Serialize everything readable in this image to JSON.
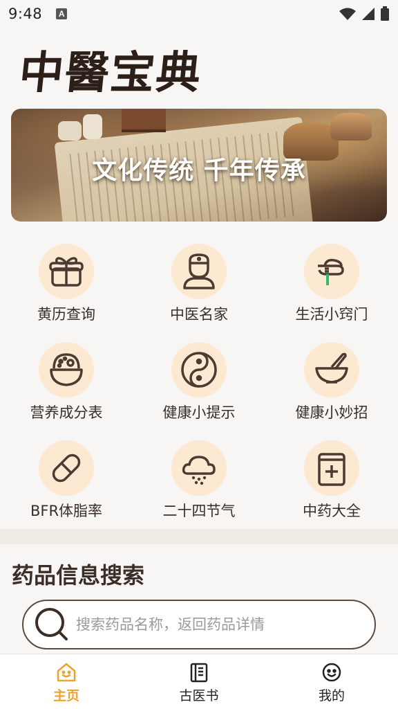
{
  "status_bar": {
    "time": "9:48",
    "notification_letter": "A"
  },
  "app": {
    "logo_text": "中醫宝典"
  },
  "banner": {
    "text": "文化传统  千年传承"
  },
  "features": [
    {
      "label": "黄历查询",
      "icon": "gift-icon"
    },
    {
      "label": "中医名家",
      "icon": "doctor-icon"
    },
    {
      "label": "生活小窍门",
      "icon": "thermometer-hand-icon"
    },
    {
      "label": "营养成分表",
      "icon": "food-bowl-icon"
    },
    {
      "label": "健康小提示",
      "icon": "yin-yang-icon"
    },
    {
      "label": "健康小妙招",
      "icon": "mortar-pestle-icon"
    },
    {
      "label": "BFR体脂率",
      "icon": "pill-capsule-icon"
    },
    {
      "label": "二十四节气",
      "icon": "snow-cloud-icon"
    },
    {
      "label": "中药大全",
      "icon": "medicine-book-icon"
    }
  ],
  "search": {
    "title": "药品信息搜索",
    "placeholder": "搜索药品名称，返回药品详情",
    "value": ""
  },
  "bottom_nav": [
    {
      "label": "主页",
      "icon": "home-icon",
      "active": true
    },
    {
      "label": "古医书",
      "icon": "ancient-book-icon",
      "active": false
    },
    {
      "label": "我的",
      "icon": "smiley-icon",
      "active": false
    }
  ],
  "colors": {
    "accent": "#f0a12b",
    "icon_bg": "#fde9d2",
    "icon_stroke": "#4a3b33",
    "background": "#f7f6f5"
  }
}
